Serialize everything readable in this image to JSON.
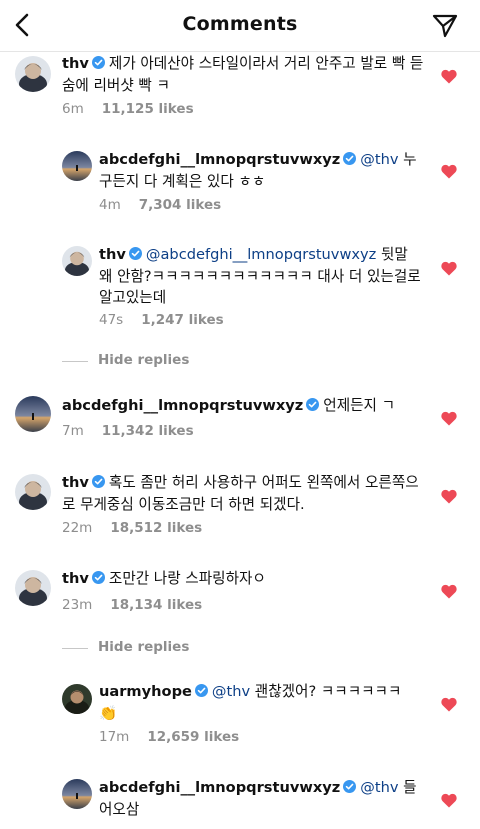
{
  "header": {
    "title": "Comments"
  },
  "colors": {
    "heart": "#ed4956",
    "verified": "#3897f0",
    "mention": "#0d3f86",
    "meta": "#8e8e8e"
  },
  "comments": [
    {
      "username": "thv",
      "verified": true,
      "mention": "",
      "text": "제가 아데산야 스타일이라서 거리 안주고 발로 빡 듣숨에 리버샷 빡 ㅋ",
      "time": "6m",
      "likes": "11,125 likes",
      "liked": true
    },
    {
      "username": "abcdefghi__lmnopqrstuvwxyz",
      "verified": true,
      "mention": "@thv",
      "text": "누구든지 다 계획은 있다 ㅎㅎ",
      "time": "4m",
      "likes": "7,304 likes",
      "liked": true
    },
    {
      "username": "thv",
      "verified": true,
      "mention": "@abcdefghi__lmnopqrstuvwxyz",
      "text": "뒷말 왜 안함?ㅋㅋㅋㅋㅋㅋㅋㅋㅋㅋㅋㅋ 대사 더 있는걸로 알고있는데",
      "time": "47s",
      "likes": "1,247 likes",
      "liked": true
    },
    {
      "username": "abcdefghi__lmnopqrstuvwxyz",
      "verified": true,
      "mention": "",
      "text": "언제든지 ㄱ",
      "time": "7m",
      "likes": "11,342 likes",
      "liked": true
    },
    {
      "username": "thv",
      "verified": true,
      "mention": "",
      "text": "혹도 좀만 허리 사용하구 어퍼도 왼쪽에서 오른쪽으로 무게중심 이동조금만 더 하면 되겠다.",
      "time": "22m",
      "likes": "18,512 likes",
      "liked": true
    },
    {
      "username": "thv",
      "verified": true,
      "mention": "",
      "text": "조만간 나랑 스파링하자ㅇ",
      "time": "23m",
      "likes": "18,134 likes",
      "liked": true
    },
    {
      "username": "uarmyhope",
      "verified": true,
      "mention": "@thv",
      "text": "괜찮겠어? ㅋㅋㅋㅋㅋㅋ 👏",
      "time": "17m",
      "likes": "12,659 likes",
      "liked": true
    },
    {
      "username": "abcdefghi__lmnopqrstuvwxyz",
      "verified": true,
      "mention": "@thv",
      "text": "들어오삼",
      "time": "",
      "likes": "",
      "liked": true
    }
  ],
  "hide_replies": [
    {
      "label": "Hide replies"
    },
    {
      "label": "Hide replies"
    }
  ]
}
